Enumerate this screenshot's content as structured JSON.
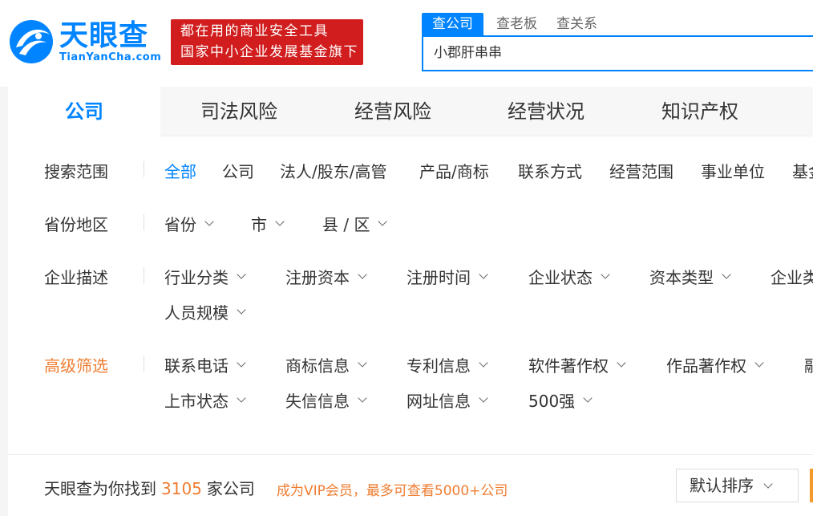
{
  "logo": {
    "cn": "天眼查",
    "en": "TianYanCha.com"
  },
  "slogan": {
    "line1": "都在用的商业安全工具",
    "line2": "国家中小企业发展基金旗下"
  },
  "search": {
    "tabs": [
      "查公司",
      "查老板",
      "查关系"
    ],
    "value": "小郡肝串串"
  },
  "categories": [
    "公司",
    "司法风险",
    "经营风险",
    "经营状况",
    "知识产权"
  ],
  "filters": {
    "scope": {
      "label": "搜索范围",
      "options": [
        "全部",
        "公司",
        "法人/股东/高管",
        "产品/商标",
        "联系方式",
        "经营范围",
        "事业单位",
        "基金"
      ]
    },
    "region": {
      "label": "省份地区",
      "options": [
        "省份",
        "市",
        "县 / 区"
      ]
    },
    "desc": {
      "label": "企业描述",
      "options": [
        "行业分类",
        "注册资本",
        "注册时间",
        "企业状态",
        "资本类型",
        "企业类",
        "人员规模"
      ]
    },
    "advanced": {
      "label": "高级筛选",
      "options": [
        "联系电话",
        "商标信息",
        "专利信息",
        "软件著作权",
        "作品著作权",
        "融",
        "上市状态",
        "失信信息",
        "网址信息",
        "500强"
      ]
    }
  },
  "result": {
    "prefix": "天眼查为你找到",
    "count": "3105",
    "suffix": "家公司",
    "vip": "成为VIP会员，最多可查看5000+公司"
  },
  "sort": {
    "label": "默认排序"
  },
  "colors": {
    "brand": "#0084ff",
    "accent": "#ef7d31",
    "slogan_bg": "#d11d1d"
  }
}
